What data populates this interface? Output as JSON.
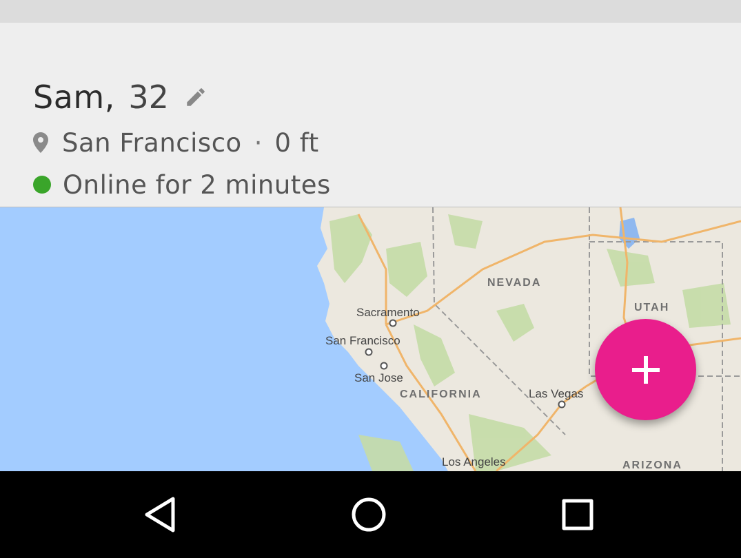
{
  "profile": {
    "name": "Sam",
    "comma": ",",
    "age": "32",
    "location": "San Francisco",
    "separator": "·",
    "distance": "0 ft",
    "status": "Online for 2 minutes"
  },
  "map": {
    "states": [
      "NEVADA",
      "UTAH",
      "CALIFORNIA",
      "ARIZONA"
    ],
    "cities": [
      "Sacramento",
      "San Francisco",
      "San Jose",
      "Las Vegas",
      "Los Angeles"
    ]
  },
  "colors": {
    "accent": "#e91e8c",
    "online": "#3aa52a",
    "ocean": "#a3ccff",
    "land": "#ece8df"
  },
  "icons": {
    "edit": "pencil-icon",
    "location": "map-pin-icon",
    "add": "plus-icon",
    "back": "back-triangle-icon",
    "home": "home-circle-icon",
    "recents": "recents-square-icon"
  }
}
